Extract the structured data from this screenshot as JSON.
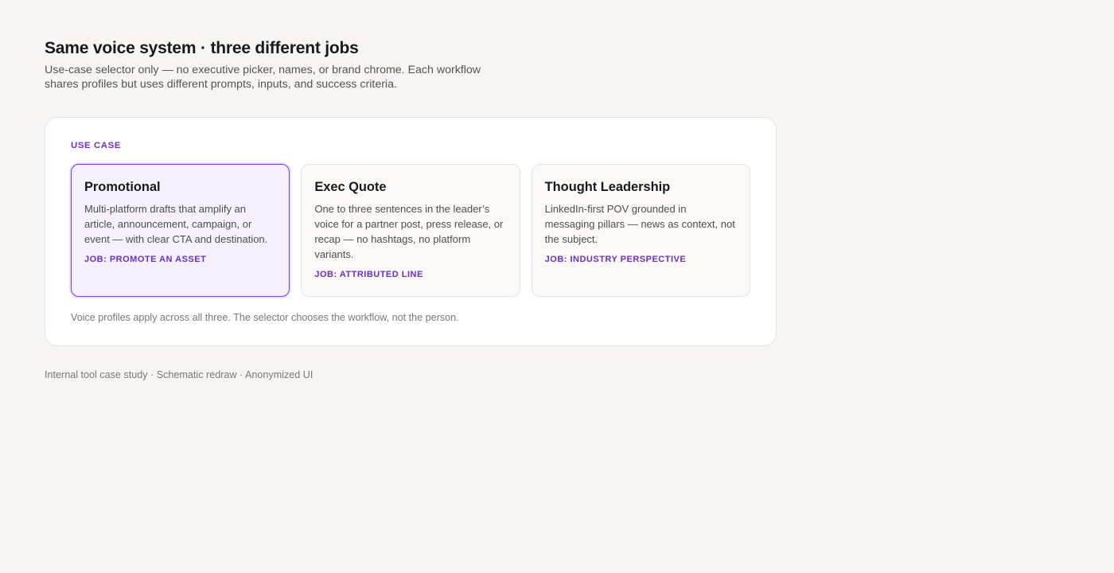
{
  "header": {
    "title": "Same voice system · three different jobs",
    "subtitle": "Use-case selector only — no executive picker, names, or brand chrome. Each workflow shares profiles but uses different prompts, inputs, and success criteria."
  },
  "selector": {
    "label": "USE CASE",
    "selected_index": 0,
    "options": [
      {
        "title": "Promotional",
        "description": "Multi-platform drafts that amplify an article, announcement, campaign, or event — with clear CTA and destination.",
        "job": "JOB: PROMOTE AN ASSET"
      },
      {
        "title": "Exec Quote",
        "description": "One to three sentences in the leader’s voice for a partner post, press release, or recap — no hashtags, no platform variants.",
        "job": "JOB: ATTRIBUTED LINE"
      },
      {
        "title": "Thought Leadership",
        "description": "LinkedIn-first POV grounded in messaging pillars — news as context, not the subject.",
        "job": "JOB: INDUSTRY PERSPECTIVE"
      }
    ],
    "note": "Voice profiles apply across all three. The selector chooses the workflow, not the person."
  },
  "footer": {
    "note": "Internal tool case study · Schematic redraw · Anonymized UI"
  },
  "colors": {
    "accent": "#6b2fc7",
    "selected_border": "#7c3fd6",
    "selected_bg": "#f4f1fd",
    "page_bg": "#f6f5f3"
  }
}
